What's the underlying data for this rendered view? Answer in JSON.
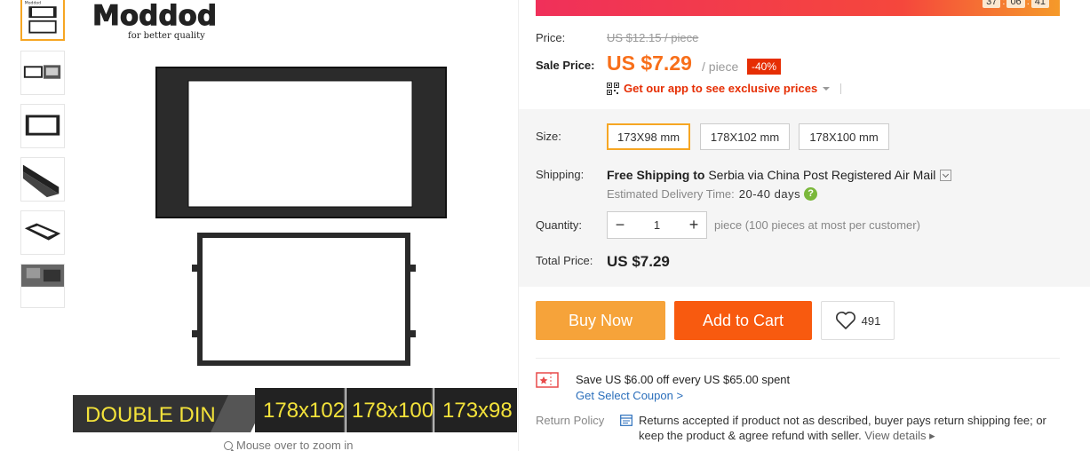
{
  "thumbnails": [
    {
      "name": "thumb-1",
      "active": true
    },
    {
      "name": "thumb-2",
      "active": false
    },
    {
      "name": "thumb-3",
      "active": false
    },
    {
      "name": "thumb-4",
      "active": false
    },
    {
      "name": "thumb-5",
      "active": false
    },
    {
      "name": "thumb-6",
      "active": false
    }
  ],
  "product_image": {
    "brand_logo": "Moddod",
    "brand_tagline": "for better quality",
    "banner_label": "DOUBLE DIN",
    "banner_sizes": [
      "178x102",
      "178x100",
      "173x98"
    ],
    "zoom_hint": "Mouse over to zoom in"
  },
  "countdown": {
    "hours": "37",
    "minutes": "06",
    "seconds": "41"
  },
  "price": {
    "label": "Price:",
    "original": "US $12.15 / piece",
    "sale_label": "Sale Price:",
    "sale_value": "US $7.29",
    "sale_unit": "/ piece",
    "discount": "-40%",
    "app_promo": "Get our app to see exclusive prices"
  },
  "size": {
    "label": "Size:",
    "options": [
      "173X98 mm",
      "178X102 mm",
      "178X100 mm"
    ],
    "selected": "173X98 mm"
  },
  "shipping": {
    "label": "Shipping:",
    "free": "Free Shipping to",
    "destination": "Serbia via China Post Registered Air Mail",
    "delivery_label": "Estimated Delivery Time:",
    "delivery_days": "20-40 days"
  },
  "quantity": {
    "label": "Quantity:",
    "value": "1",
    "note": "piece (100 pieces at most per customer)"
  },
  "total": {
    "label": "Total Price:",
    "value": "US $7.29"
  },
  "actions": {
    "buy_now": "Buy Now",
    "add_to_cart": "Add to Cart",
    "wishlist_count": "491"
  },
  "coupon": {
    "text": "Save US $6.00 off every US $65.00 spent",
    "link": "Get Select Coupon >"
  },
  "return_policy": {
    "label": "Return Policy",
    "text": "Returns accepted if product not as described, buyer pays return shipping fee; or keep the product & agree refund with seller.",
    "link": "View details"
  },
  "colors": {
    "accent_orange": "#f86f1a",
    "buy_now": "#f6a33a",
    "add_to_cart": "#f85a0f",
    "discount_red": "#e62e04",
    "selected_border": "#f6a623"
  }
}
